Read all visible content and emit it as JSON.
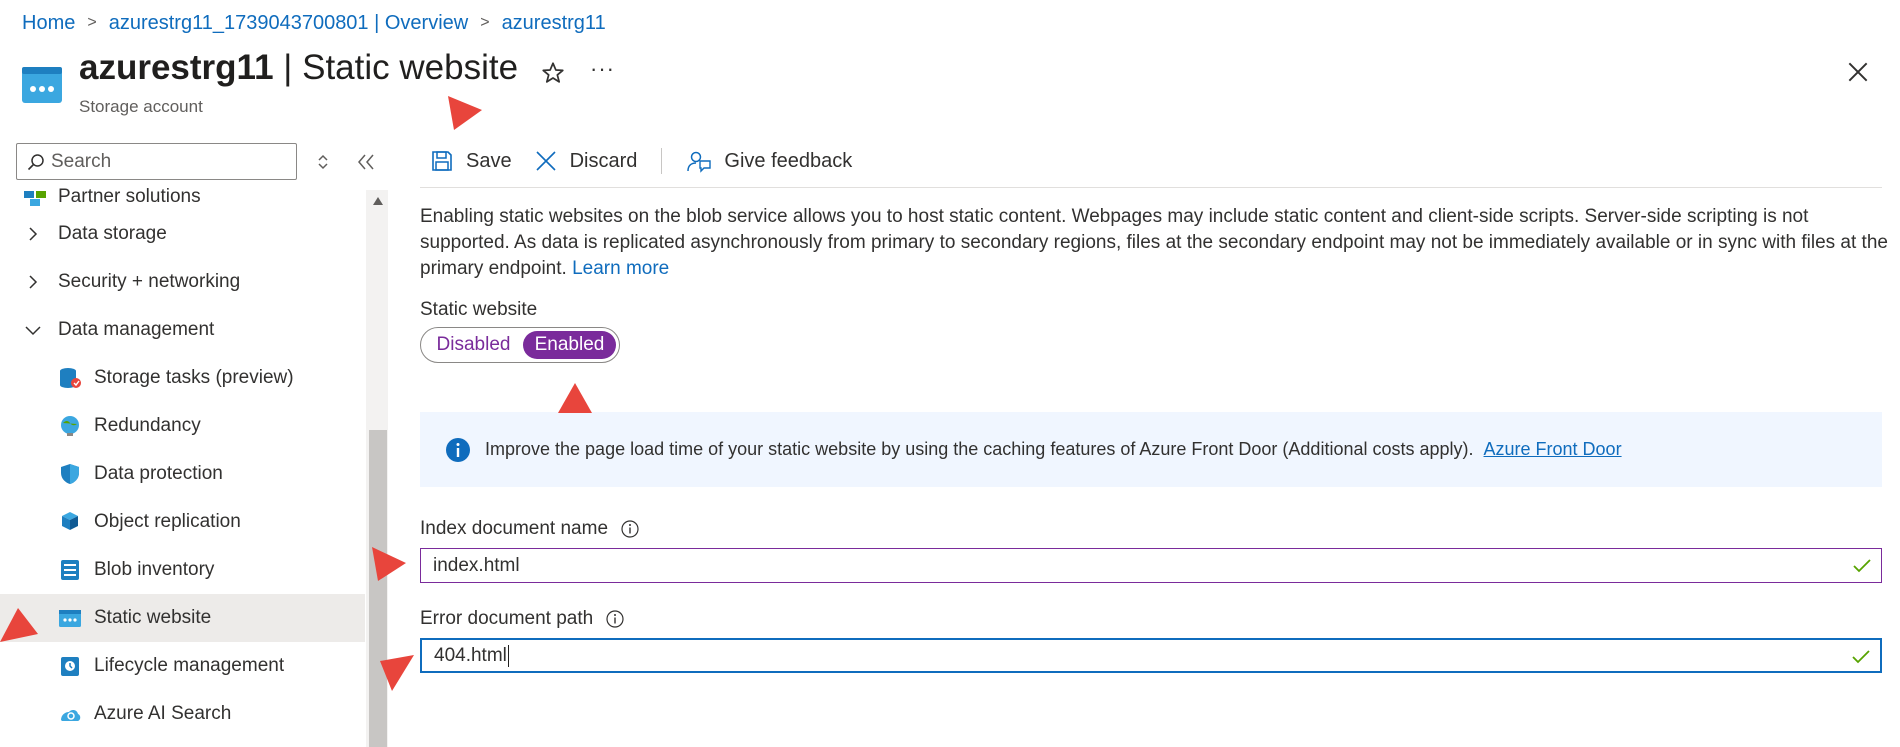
{
  "breadcrumb": {
    "items": [
      "Home",
      "azurestrg11_1739043700801 | Overview",
      "azurestrg11"
    ]
  },
  "header": {
    "resource_name": "azurestrg11",
    "separator": " | ",
    "blade_title": "Static website",
    "subtitle": "Storage account",
    "more": "···"
  },
  "sidebar": {
    "search_placeholder": "Search",
    "items": [
      {
        "label": "Partner solutions",
        "icon": "partner-solutions-icon"
      },
      {
        "label": "Data storage",
        "expandable": true,
        "expanded": false
      },
      {
        "label": "Security + networking",
        "expandable": true,
        "expanded": false
      },
      {
        "label": "Data management",
        "expandable": true,
        "expanded": true
      },
      {
        "label": "Storage tasks (preview)",
        "icon": "storage-tasks-icon"
      },
      {
        "label": "Redundancy",
        "icon": "redundancy-icon"
      },
      {
        "label": "Data protection",
        "icon": "data-protection-icon"
      },
      {
        "label": "Object replication",
        "icon": "object-replication-icon"
      },
      {
        "label": "Blob inventory",
        "icon": "blob-inventory-icon"
      },
      {
        "label": "Static website",
        "icon": "static-website-icon",
        "selected": true
      },
      {
        "label": "Lifecycle management",
        "icon": "lifecycle-management-icon"
      },
      {
        "label": "Azure AI Search",
        "icon": "azure-ai-search-icon"
      }
    ]
  },
  "toolbar": {
    "save": "Save",
    "discard": "Discard",
    "feedback": "Give feedback"
  },
  "content": {
    "description": "Enabling static websites on the blob service allows you to host static content. Webpages may include static content and client-side scripts. Server-side scripting is not supported. As data is replicated asynchronously from primary to secondary regions, files at the secondary endpoint may not be immediately available or in sync with files at the primary endpoint.",
    "learn_more": "Learn more",
    "static_website_label": "Static website",
    "toggle": {
      "disabled": "Disabled",
      "enabled": "Enabled",
      "selected": "Enabled"
    },
    "info_text": "Improve the page load time of your static website by using the caching features of Azure Front Door (Additional costs apply).",
    "info_link": "Azure Front Door",
    "index_label": "Index document name",
    "index_value": "index.html",
    "error_label": "Error document path",
    "error_value": "404.html"
  },
  "colors": {
    "link": "#0f6cbd",
    "toggle_accent": "#7a2b9b",
    "annotation_arrow": "#e8453c",
    "valid_check": "#57a300"
  }
}
